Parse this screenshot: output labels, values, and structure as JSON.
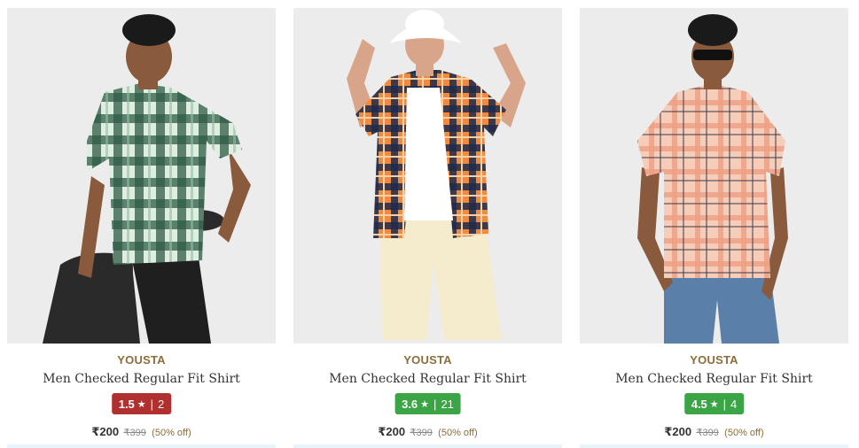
{
  "products": [
    {
      "brand": "YOUSTA",
      "name": "Men Checked Regular Fit Shirt",
      "rating": "1.5",
      "rating_star": "★",
      "rating_sep": "|",
      "rating_count": "2",
      "rating_color": "#b03030",
      "price": "₹200",
      "mrp": "₹399",
      "discount": "(50% off)"
    },
    {
      "brand": "YOUSTA",
      "name": "Men Checked Regular Fit Shirt",
      "rating": "3.6",
      "rating_star": "★",
      "rating_sep": "|",
      "rating_count": "21",
      "rating_color": "#3ba445",
      "price": "₹200",
      "mrp": "₹399",
      "discount": "(50% off)"
    },
    {
      "brand": "YOUSTA",
      "name": "Men Checked Regular Fit Shirt",
      "rating": "4.5",
      "rating_star": "★",
      "rating_sep": "|",
      "rating_count": "4",
      "rating_color": "#3ba445",
      "price": "₹200",
      "mrp": "₹399",
      "discount": "(50% off)"
    }
  ]
}
